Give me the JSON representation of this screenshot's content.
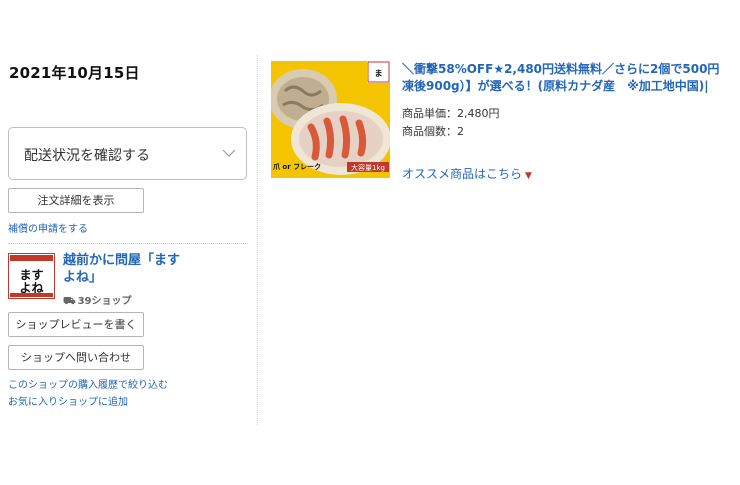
{
  "order": {
    "date": "2021年10月15日"
  },
  "tracking": {
    "label": "配送状況を確認する"
  },
  "actions": {
    "details_button": "注文詳細を表示",
    "claim_link": "補償の申請をする"
  },
  "shop": {
    "name": "越前かに問屋「ますよね」",
    "badge": "39ショップ",
    "review_button": "ショップレビューを書く",
    "contact_button": "ショップへ問い合わせ",
    "history_link": "このショップの購入履歴で絞り込む",
    "favorite_link": "お気に入りショップに追加",
    "logo_icon": "shop-logo-icon",
    "logo_text": "ますよね"
  },
  "product": {
    "title_line1": "＼衝撃58%OFF★2,480円送料無料／さらに2個で500円",
    "title_line2": "凍後900g）】が選べる！(原料カナダ産　※加工地中国)|",
    "unit_price": "商品単価：2,480円",
    "quantity": "商品個数：2",
    "image_caption": "爪 or フレーク",
    "image_badge": "大容量1kg"
  },
  "recommend": {
    "label": "オススメ商品はこちら"
  },
  "colors": {
    "link": "#2266b8",
    "accent_red": "#c0392b",
    "image_yellow": "#f5c400"
  }
}
